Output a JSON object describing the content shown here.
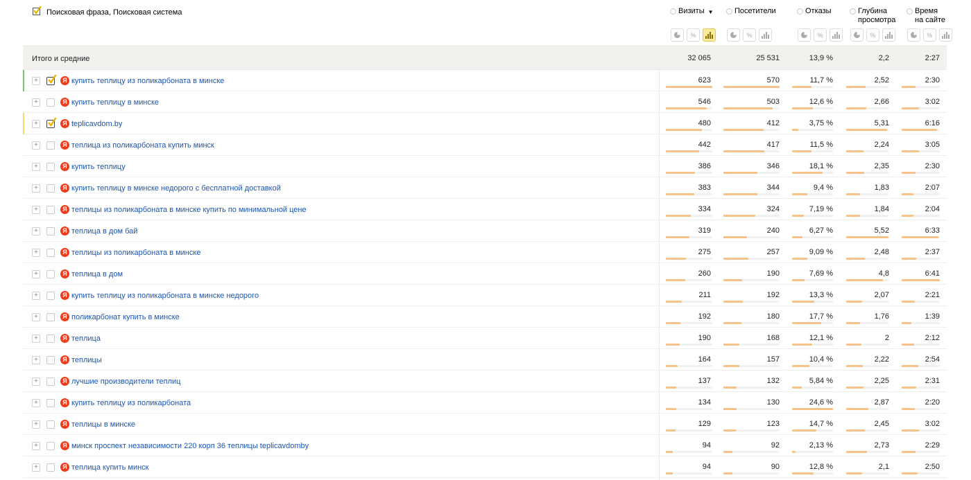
{
  "header": {
    "phrase_title": "Поисковая фраза, Поисковая система",
    "metrics": [
      {
        "label_lines": [
          "Визиты"
        ],
        "sorted": true
      },
      {
        "label_lines": [
          "Посетители"
        ],
        "sorted": false
      },
      {
        "label_lines": [
          "Отказы"
        ],
        "sorted": false
      },
      {
        "label_lines": [
          "Глубина",
          "просмотра"
        ],
        "sorted": false
      },
      {
        "label_lines": [
          "Время",
          "на сайте"
        ],
        "sorted": false
      }
    ],
    "sort_indicator": "▼",
    "modes": {
      "pie": "pie-chart-icon",
      "percent": "%",
      "bars": "bar-chart-icon"
    }
  },
  "totals": {
    "label": "Итого и средние",
    "visits": "32 065",
    "visitors": "25 531",
    "bounce": "13,9 %",
    "depth": "2,2",
    "time": "2:27"
  },
  "rows": [
    {
      "phrase": "купить теплицу из поликарбоната в минске",
      "checked": true,
      "marker": "#7cc36a",
      "visits": "623",
      "visitors": "570",
      "bounce": "11,7 %",
      "depth": "2,52",
      "time": "2:30",
      "fill": [
        1.0,
        1.0,
        0.48,
        0.46,
        0.37
      ]
    },
    {
      "phrase": "купить теплицу в минске",
      "checked": false,
      "marker": "",
      "visits": "546",
      "visitors": "503",
      "bounce": "12,6 %",
      "depth": "2,66",
      "time": "3:02",
      "fill": [
        0.88,
        0.88,
        0.51,
        0.48,
        0.45
      ]
    },
    {
      "phrase": "teplicavdom.by",
      "checked": true,
      "marker": "#f5d86a",
      "visits": "480",
      "visitors": "412",
      "bounce": "3,75 %",
      "depth": "5,31",
      "time": "6:16",
      "fill": [
        0.77,
        0.72,
        0.15,
        0.96,
        0.93
      ]
    },
    {
      "phrase": "теплица из поликарбоната купить минск",
      "checked": false,
      "marker": "",
      "visits": "442",
      "visitors": "417",
      "bounce": "11,5 %",
      "depth": "2,24",
      "time": "3:05",
      "fill": [
        0.71,
        0.73,
        0.47,
        0.41,
        0.46
      ]
    },
    {
      "phrase": "купить теплицу",
      "checked": false,
      "marker": "",
      "visits": "386",
      "visitors": "346",
      "bounce": "18,1 %",
      "depth": "2,35",
      "time": "2:30",
      "fill": [
        0.62,
        0.61,
        0.74,
        0.43,
        0.37
      ]
    },
    {
      "phrase": "купить теплицу в минске недорого с бесплатной доставкой",
      "checked": false,
      "marker": "",
      "visits": "383",
      "visitors": "344",
      "bounce": "9,4 %",
      "depth": "1,83",
      "time": "2:07",
      "fill": [
        0.61,
        0.6,
        0.38,
        0.33,
        0.31
      ]
    },
    {
      "phrase": "теплицы из поликарбоната в минске купить по минимальной цене",
      "checked": false,
      "marker": "",
      "visits": "334",
      "visitors": "324",
      "bounce": "7,19 %",
      "depth": "1,84",
      "time": "2:04",
      "fill": [
        0.54,
        0.57,
        0.29,
        0.33,
        0.31
      ]
    },
    {
      "phrase": "теплица в дом бай",
      "checked": false,
      "marker": "",
      "visits": "319",
      "visitors": "240",
      "bounce": "6,27 %",
      "depth": "5,52",
      "time": "6:33",
      "fill": [
        0.51,
        0.42,
        0.26,
        1.0,
        0.97
      ]
    },
    {
      "phrase": "теплицы из поликарбоната в минске",
      "checked": false,
      "marker": "",
      "visits": "275",
      "visitors": "257",
      "bounce": "9,09 %",
      "depth": "2,48",
      "time": "2:37",
      "fill": [
        0.44,
        0.45,
        0.37,
        0.45,
        0.39
      ]
    },
    {
      "phrase": "теплица в дом",
      "checked": false,
      "marker": "",
      "visits": "260",
      "visitors": "190",
      "bounce": "7,69 %",
      "depth": "4,8",
      "time": "6:41",
      "fill": [
        0.42,
        0.33,
        0.31,
        0.87,
        1.0
      ]
    },
    {
      "phrase": "купить теплицу из поликарбоната в минске недорого",
      "checked": false,
      "marker": "",
      "visits": "211",
      "visitors": "192",
      "bounce": "13,3 %",
      "depth": "2,07",
      "time": "2:21",
      "fill": [
        0.34,
        0.34,
        0.54,
        0.38,
        0.35
      ]
    },
    {
      "phrase": "поликарбонат купить в минске",
      "checked": false,
      "marker": "",
      "visits": "192",
      "visitors": "180",
      "bounce": "17,7 %",
      "depth": "1,76",
      "time": "1:39",
      "fill": [
        0.31,
        0.32,
        0.72,
        0.32,
        0.25
      ]
    },
    {
      "phrase": "теплица",
      "checked": false,
      "marker": "",
      "visits": "190",
      "visitors": "168",
      "bounce": "12,1 %",
      "depth": "2",
      "time": "2:12",
      "fill": [
        0.3,
        0.29,
        0.49,
        0.36,
        0.33
      ]
    },
    {
      "phrase": "теплицы",
      "checked": false,
      "marker": "",
      "visits": "164",
      "visitors": "157",
      "bounce": "10,4 %",
      "depth": "2,22",
      "time": "2:54",
      "fill": [
        0.26,
        0.28,
        0.42,
        0.4,
        0.43
      ]
    },
    {
      "phrase": "лучшие производители теплиц",
      "checked": false,
      "marker": "",
      "visits": "137",
      "visitors": "132",
      "bounce": "5,84 %",
      "depth": "2,25",
      "time": "2:31",
      "fill": [
        0.22,
        0.23,
        0.24,
        0.41,
        0.38
      ]
    },
    {
      "phrase": "купить теплицу из поликарбоната",
      "checked": false,
      "marker": "",
      "visits": "134",
      "visitors": "130",
      "bounce": "24,6 %",
      "depth": "2,87",
      "time": "2:20",
      "fill": [
        0.22,
        0.23,
        1.0,
        0.52,
        0.35
      ]
    },
    {
      "phrase": "теплицы в минске",
      "checked": false,
      "marker": "",
      "visits": "129",
      "visitors": "123",
      "bounce": "14,7 %",
      "depth": "2,45",
      "time": "3:02",
      "fill": [
        0.21,
        0.22,
        0.6,
        0.44,
        0.45
      ]
    },
    {
      "phrase": "минск проспект независимости 220 корп 36 теплицы teplicavdomby",
      "checked": false,
      "marker": "",
      "visits": "94",
      "visitors": "92",
      "bounce": "2,13 %",
      "depth": "2,73",
      "time": "2:29",
      "fill": [
        0.15,
        0.16,
        0.09,
        0.49,
        0.37
      ]
    },
    {
      "phrase": "теплица купить минск",
      "checked": false,
      "marker": "",
      "visits": "94",
      "visitors": "90",
      "bounce": "12,8 %",
      "depth": "2,1",
      "time": "2:50",
      "fill": [
        0.15,
        0.16,
        0.52,
        0.38,
        0.42
      ]
    }
  ]
}
